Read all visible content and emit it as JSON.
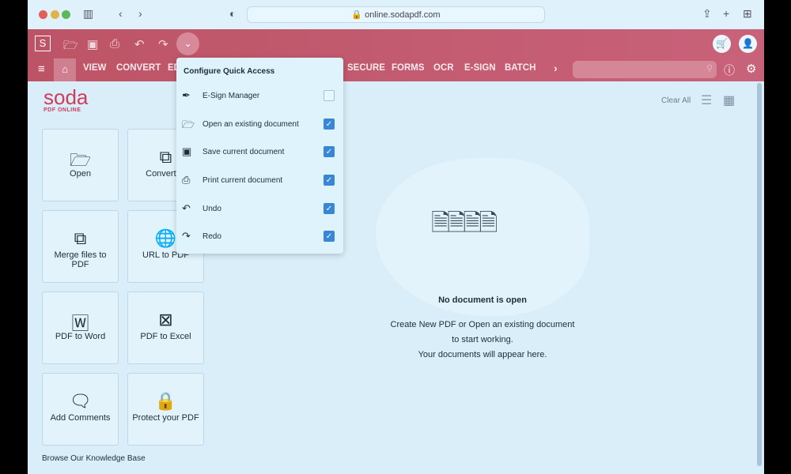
{
  "browser": {
    "url": "online.sodapdf.com"
  },
  "toolbar": {
    "logo_letter": "S"
  },
  "nav": {
    "items": [
      "VIEW",
      "CONVERT",
      "ED",
      "SECURE",
      "FORMS",
      "OCR",
      "E-SIGN",
      "BATCH"
    ]
  },
  "brand": {
    "name": "soda",
    "sub": "PDF ONLINE"
  },
  "header": {
    "clear_all": "Clear All"
  },
  "tiles": [
    {
      "label": "Open",
      "icon": "folder-open"
    },
    {
      "label": "Convert to",
      "icon": "convert"
    },
    {
      "label": "Merge files to PDF",
      "icon": "merge"
    },
    {
      "label": "URL to PDF",
      "icon": "globe"
    },
    {
      "label": "PDF to Word",
      "icon": "word"
    },
    {
      "label": "PDF to Excel",
      "icon": "excel"
    },
    {
      "label": "Add Comments",
      "icon": "comment"
    },
    {
      "label": "Protect your PDF",
      "icon": "lock"
    }
  ],
  "knowledge_base": "Browse Our Knowledge Base",
  "menu": {
    "title": "Configure Quick Access",
    "items": [
      {
        "label": "E-Sign Manager",
        "checked": false
      },
      {
        "label": "Open an existing document",
        "checked": true
      },
      {
        "label": "Save current document",
        "checked": true
      },
      {
        "label": "Print current document",
        "checked": true
      },
      {
        "label": "Undo",
        "checked": true
      },
      {
        "label": "Redo",
        "checked": true
      }
    ]
  },
  "empty": {
    "title": "No document is open",
    "line1": "Create New PDF or Open an existing document",
    "line2": "to start working.",
    "line3": "Your documents will appear here.",
    "doc_label": "pdf"
  },
  "colors": {
    "accent": "#c0566a",
    "check": "#3a86d6"
  }
}
